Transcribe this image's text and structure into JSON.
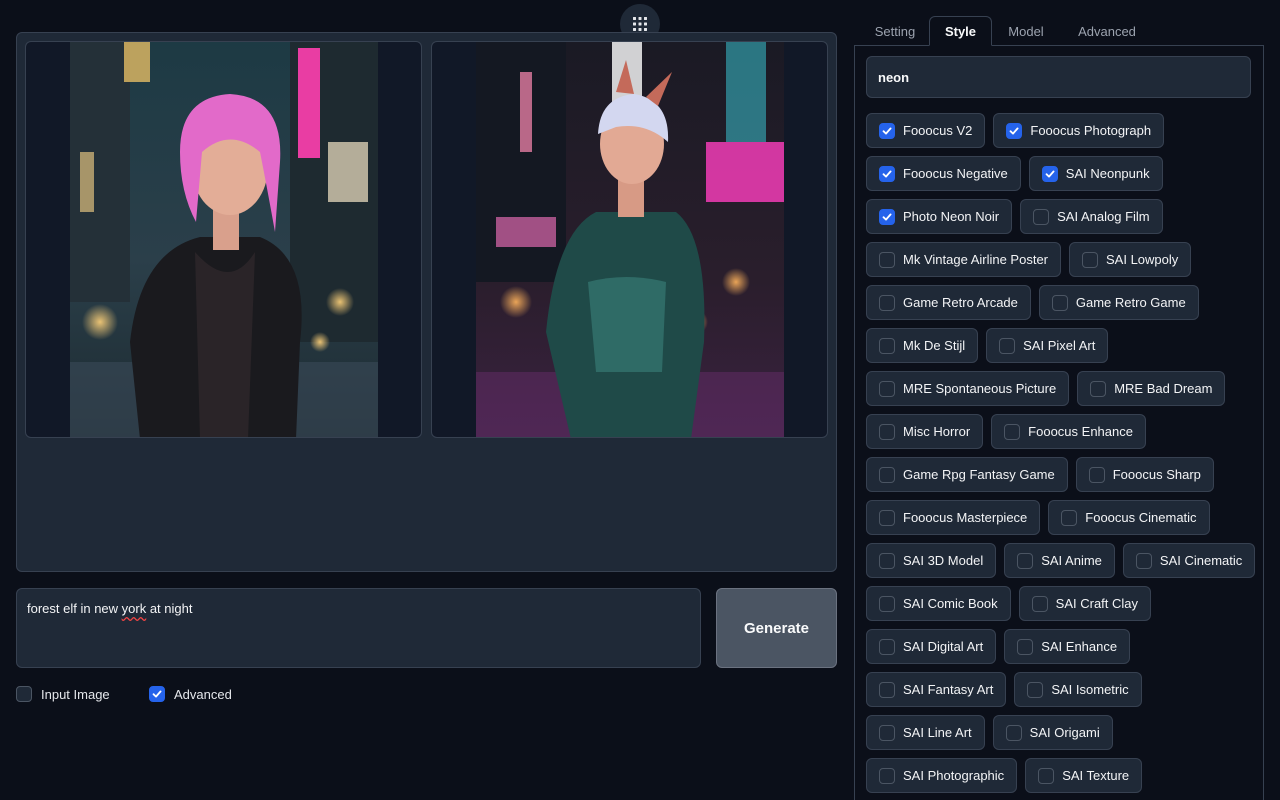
{
  "gallery": {
    "images": [
      {
        "alt": "",
        "icon": "image"
      },
      {
        "alt": "",
        "icon": "image"
      }
    ]
  },
  "prompt": {
    "before": "forest elf in new ",
    "misspelled": "york",
    "after": " at night"
  },
  "generate_label": "Generate",
  "options": {
    "input_image": {
      "label": "Input Image",
      "checked": false
    },
    "advanced": {
      "label": "Advanced",
      "checked": true
    }
  },
  "tabs": [
    {
      "label": "Setting",
      "active": false
    },
    {
      "label": "Style",
      "active": true
    },
    {
      "label": "Model",
      "active": false
    },
    {
      "label": "Advanced",
      "active": false
    }
  ],
  "style_search": {
    "value": "neon"
  },
  "styles": [
    {
      "label": "Fooocus V2",
      "checked": true
    },
    {
      "label": "Fooocus Photograph",
      "checked": true
    },
    {
      "label": "Fooocus Negative",
      "checked": true
    },
    {
      "label": "SAI Neonpunk",
      "checked": true
    },
    {
      "label": "Photo Neon Noir",
      "checked": true
    },
    {
      "label": "SAI Analog Film",
      "checked": false
    },
    {
      "label": "Mk Vintage Airline Poster",
      "checked": false
    },
    {
      "label": "SAI Lowpoly",
      "checked": false
    },
    {
      "label": "Game Retro Arcade",
      "checked": false
    },
    {
      "label": "Game Retro Game",
      "checked": false
    },
    {
      "label": "Mk De Stijl",
      "checked": false
    },
    {
      "label": "SAI Pixel Art",
      "checked": false
    },
    {
      "label": "MRE Spontaneous Picture",
      "checked": false
    },
    {
      "label": "MRE Bad Dream",
      "checked": false
    },
    {
      "label": "Misc Horror",
      "checked": false
    },
    {
      "label": "Fooocus Enhance",
      "checked": false
    },
    {
      "label": "Game Rpg Fantasy Game",
      "checked": false
    },
    {
      "label": "Fooocus Sharp",
      "checked": false
    },
    {
      "label": "Fooocus Masterpiece",
      "checked": false
    },
    {
      "label": "Fooocus Cinematic",
      "checked": false
    },
    {
      "label": "SAI 3D Model",
      "checked": false
    },
    {
      "label": "SAI Anime",
      "checked": false
    },
    {
      "label": "SAI Cinematic",
      "checked": false
    },
    {
      "label": "SAI Comic Book",
      "checked": false
    },
    {
      "label": "SAI Craft Clay",
      "checked": false
    },
    {
      "label": "SAI Digital Art",
      "checked": false
    },
    {
      "label": "SAI Enhance",
      "checked": false
    },
    {
      "label": "SAI Fantasy Art",
      "checked": false
    },
    {
      "label": "SAI Isometric",
      "checked": false
    },
    {
      "label": "SAI Line Art",
      "checked": false
    },
    {
      "label": "SAI Origami",
      "checked": false
    },
    {
      "label": "SAI Photographic",
      "checked": false
    },
    {
      "label": "SAI Texture",
      "checked": false
    }
  ],
  "colors": {
    "accent": "#2563eb",
    "background": "#0b0f19",
    "panel": "#1f2937",
    "border": "#374151"
  }
}
